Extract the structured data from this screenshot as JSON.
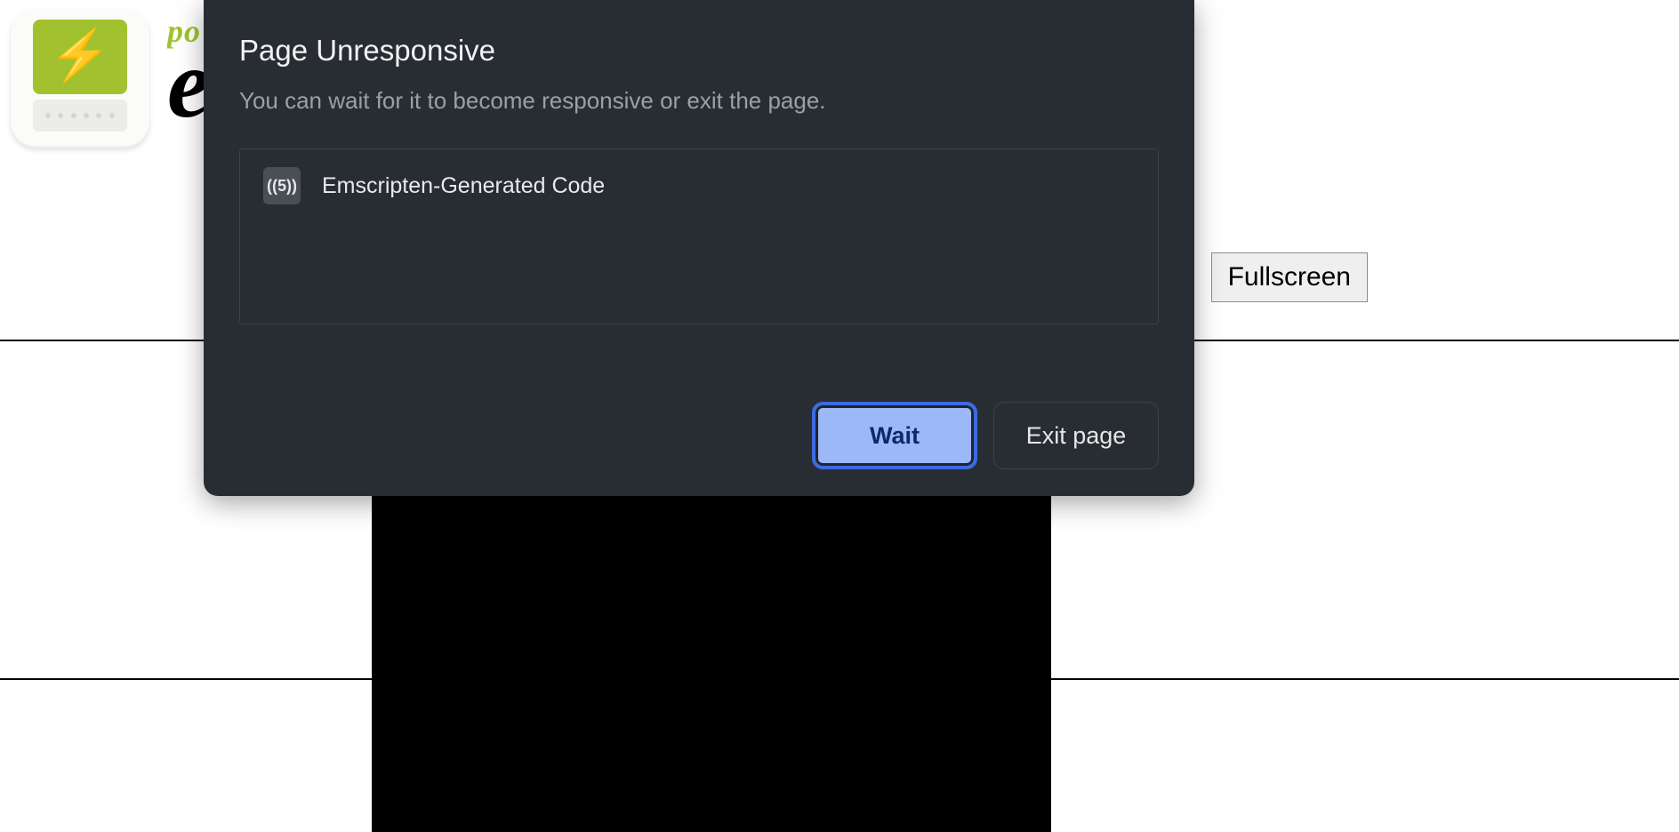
{
  "page": {
    "brand_top": "po",
    "brand_main": "el",
    "fullscreen_label": "Fullscreen"
  },
  "modal": {
    "title": "Page Unresponsive",
    "subtitle": "You can wait for it to become responsive or exit the page.",
    "item_label": "Emscripten-Generated Code",
    "favicon_text": "((5))",
    "wait_label": "Wait",
    "exit_label": "Exit page"
  }
}
